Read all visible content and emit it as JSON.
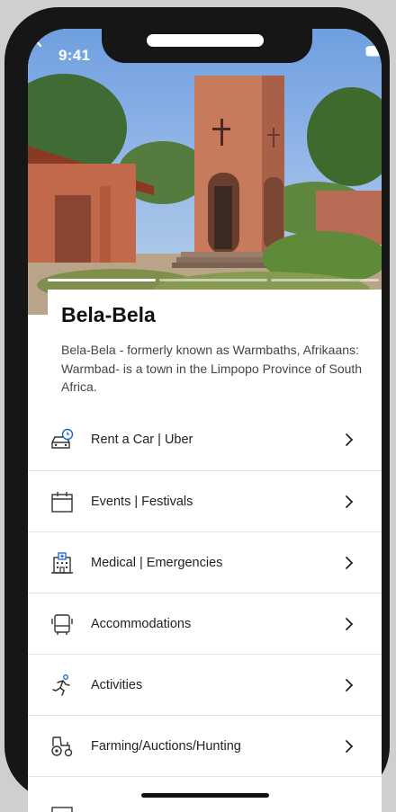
{
  "status_bar": {
    "time": "9:41"
  },
  "place": {
    "title": "Bela-Bela",
    "description": "Bela-Bela - formerly known as Warmbaths, Afrikaans: Warmbad- is a town in the Limpopo Province of South Africa."
  },
  "carousel": {
    "slide_count": 3,
    "active_index": 0
  },
  "menu": [
    {
      "label": "Rent a Car | Uber",
      "icon": "car-clock-icon"
    },
    {
      "label": "Events | Festivals",
      "icon": "calendar-icon"
    },
    {
      "label": "Medical | Emergencies",
      "icon": "hospital-icon"
    },
    {
      "label": "Accommodations",
      "icon": "bed-icon"
    },
    {
      "label": "Activities",
      "icon": "runner-icon"
    },
    {
      "label": "Farming/Auctions/Hunting",
      "icon": "tractor-icon"
    }
  ]
}
